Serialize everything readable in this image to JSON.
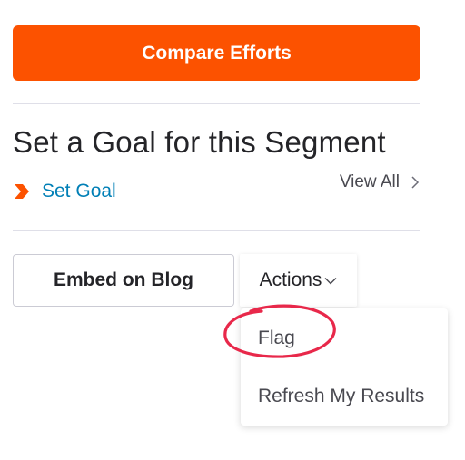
{
  "compare": {
    "label": "Compare Efforts"
  },
  "goal": {
    "heading": "Set a Goal for this Segment",
    "set_goal_label": "Set Goal",
    "set_goal_icon": "orange-chevron-icon",
    "view_all_label": "View All",
    "view_all_icon": "chevron-right-icon"
  },
  "buttons": {
    "embed_label": "Embed on Blog",
    "actions_label": "Actions",
    "actions_icon": "chevron-down-icon"
  },
  "actions_menu": {
    "items": [
      {
        "label": "Flag"
      },
      {
        "label": "Refresh My Results"
      }
    ]
  },
  "colors": {
    "brand": "#fc5200",
    "link": "#007fb6",
    "annotation": "#e8284a"
  }
}
